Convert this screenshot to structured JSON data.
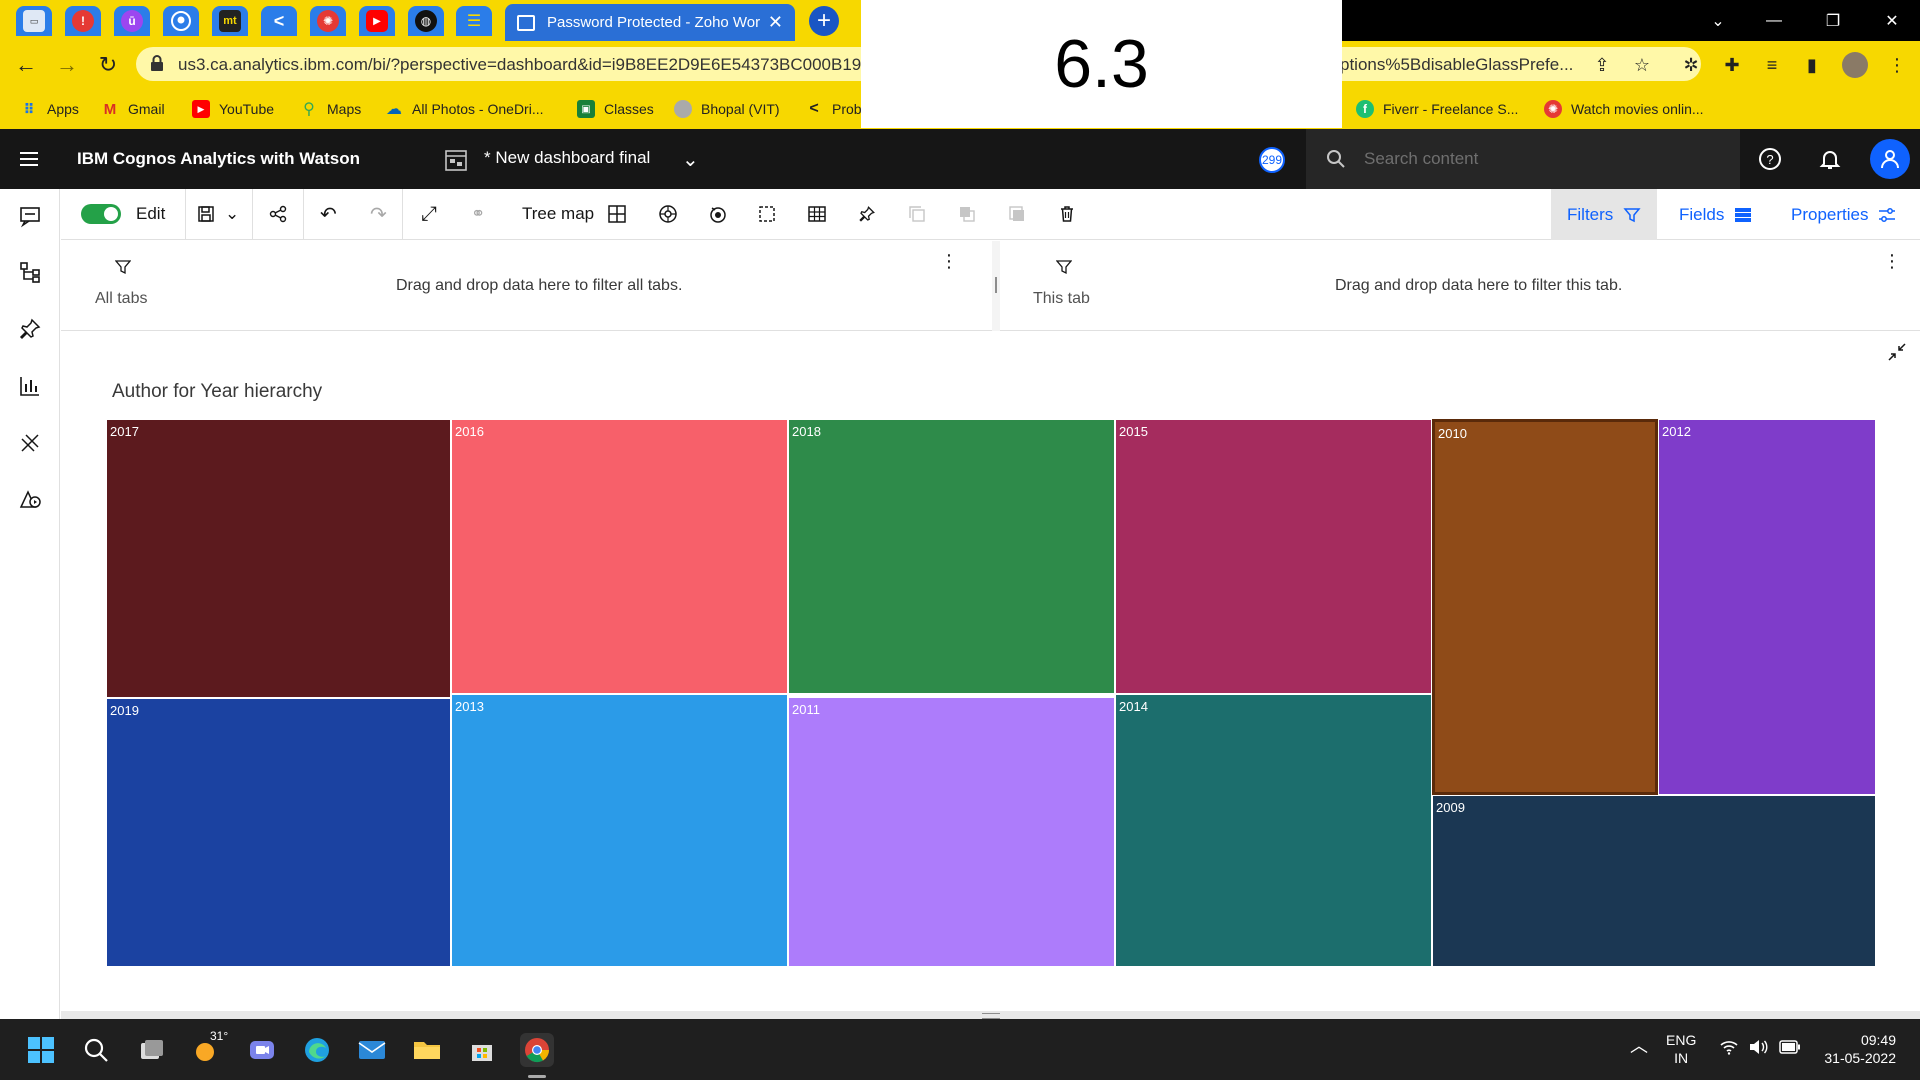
{
  "browser": {
    "active_tab_title": "Password Protected - Zoho Work",
    "url_left": "us3.ca.analytics.ibm.com/bi/?perspective=dashboard&id=i9B8EE2D9E6E54373BC000B19",
    "url_right": "ptions%5BdisableGlassPrefe...",
    "bookmarks": [
      "Apps",
      "Gmail",
      "YouTube",
      "Maps",
      "All Photos - OneDri...",
      "Classes",
      "Bhopal (VIT)",
      "Prob",
      "Fiverr - Freelance S...",
      "Watch movies onlin..."
    ]
  },
  "overlay_number": "6.3",
  "cognos": {
    "brand": "IBM Cognos Analytics with Watson",
    "dashboard_title": "* New dashboard final",
    "badge": "299",
    "search_placeholder": "Search content"
  },
  "toolbar": {
    "edit_label": "Edit",
    "viz_type_label": "Tree map",
    "filters_label": "Filters",
    "fields_label": "Fields",
    "properties_label": "Properties"
  },
  "filters": {
    "all_tabs_label": "All tabs",
    "all_tabs_hint": "Drag and drop data here to filter all tabs.",
    "this_tab_label": "This tab",
    "this_tab_hint": "Drag and drop data here to filter this tab."
  },
  "visualization": {
    "title": "Author for Year hierarchy",
    "cells": [
      {
        "label": "2017",
        "color": "#5c1a1e"
      },
      {
        "label": "2016",
        "color": "#f7606a"
      },
      {
        "label": "2018",
        "color": "#2e8b4a"
      },
      {
        "label": "2015",
        "color": "#a52c5e"
      },
      {
        "label": "2010",
        "color": "#8f4b18"
      },
      {
        "label": "2012",
        "color": "#7f3cca"
      },
      {
        "label": "2019",
        "color": "#1b42a1"
      },
      {
        "label": "2013",
        "color": "#2b9be8"
      },
      {
        "label": "2011",
        "color": "#ad7cfb"
      },
      {
        "label": "2014",
        "color": "#1c6e6d"
      },
      {
        "label": "2009",
        "color": "#1b3753"
      }
    ]
  },
  "taskbar": {
    "weather": "31°",
    "lang_top": "ENG",
    "lang_bottom": "IN",
    "time": "09:49",
    "date": "31-05-2022"
  }
}
